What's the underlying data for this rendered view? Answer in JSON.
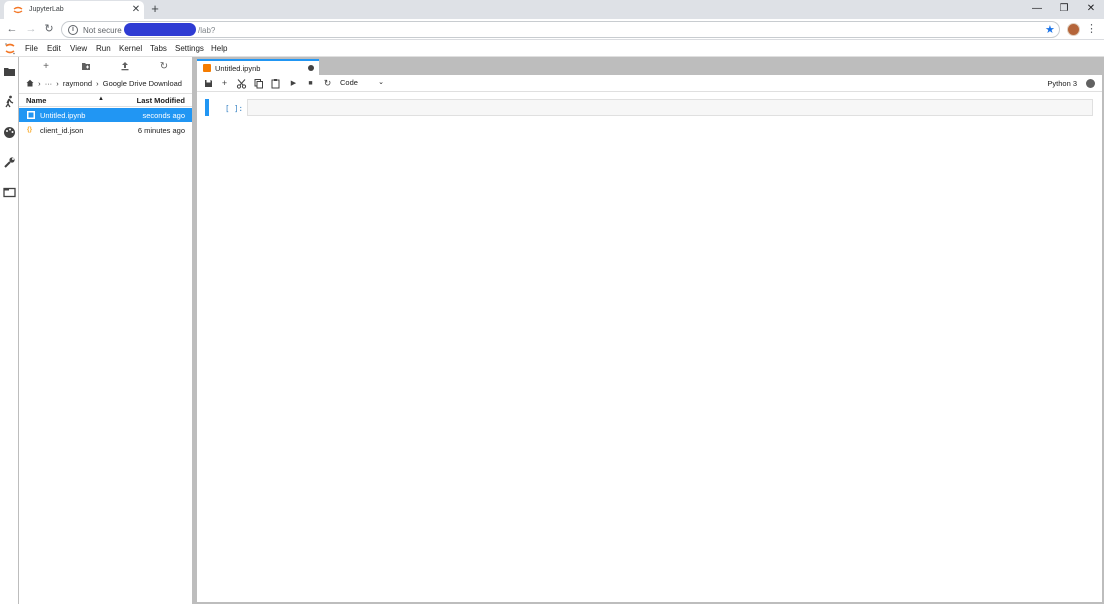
{
  "browser": {
    "tab_title": "JupyterLab",
    "tab_close": "✕",
    "new_tab": "+",
    "window_controls": {
      "minimize": "—",
      "restore": "❐",
      "close": "✕"
    },
    "nav": {
      "back": "←",
      "forward": "→",
      "reload": "↻"
    },
    "security_label": "Not secure",
    "url_path": "/lab?",
    "bookmark_icon": "star-icon",
    "menu": "⋮"
  },
  "menubar": {
    "items": [
      "File",
      "Edit",
      "View",
      "Run",
      "Kernel",
      "Tabs",
      "Settings",
      "Help"
    ]
  },
  "activity_bar": {
    "icons": [
      "folder-icon",
      "running-icon",
      "palette-icon",
      "wrench-icon",
      "tabs-icon"
    ]
  },
  "file_browser": {
    "toolbar": {
      "new_launcher": "+",
      "new_folder": "new-folder-icon",
      "upload": "upload-icon",
      "refresh": "↻"
    },
    "breadcrumbs": {
      "home_icon": "home-icon",
      "sep": "›",
      "ellipsis": "···",
      "folder1": "raymond",
      "folder2": "Google Drive Download"
    },
    "columns": {
      "name": "Name",
      "last_modified": "Last Modified",
      "sort_indicator": "▲"
    },
    "files": [
      {
        "name": "Untitled.ipynb",
        "modified": "seconds ago",
        "icon": "notebook-icon",
        "selected": true
      },
      {
        "name": "client_id.json",
        "modified": "6 minutes ago",
        "icon": "json-icon",
        "selected": false
      }
    ]
  },
  "notebook": {
    "tab_title": "Untitled.ipynb",
    "toolbar": {
      "save": "save-icon",
      "insert": "+",
      "cut": "cut-icon",
      "copy": "copy-icon",
      "paste": "paste-icon",
      "run": "▶",
      "stop": "■",
      "restart": "↻",
      "cell_type": "Code",
      "cell_type_caret": "⌄"
    },
    "kernel_name": "Python 3",
    "cell_prompt": "[ ]:"
  }
}
